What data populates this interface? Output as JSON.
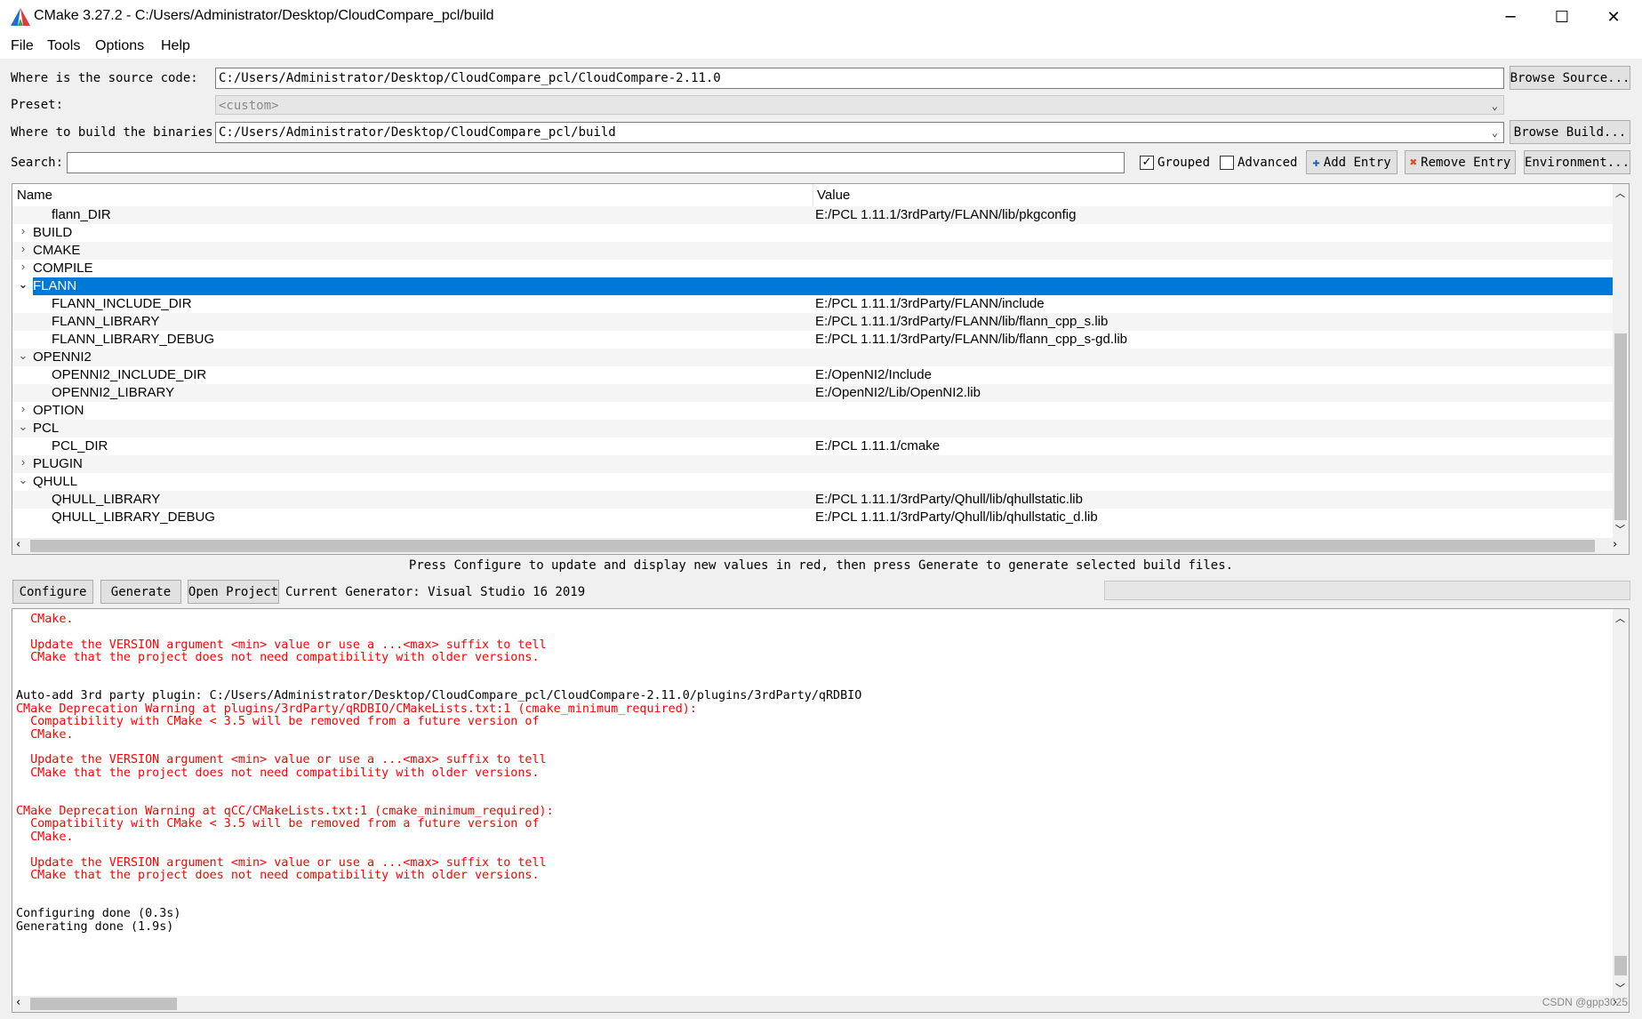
{
  "window": {
    "title": "CMake 3.27.2 - C:/Users/Administrator/Desktop/CloudCompare_pcl/build",
    "minimize": "─",
    "maximize": "☐",
    "close": "✕"
  },
  "menu": [
    "File",
    "Tools",
    "Options",
    "Help"
  ],
  "source": {
    "label": "Where is the source code:",
    "value": "C:/Users/Administrator/Desktop/CloudCompare_pcl/CloudCompare-2.11.0",
    "button": "Browse Source..."
  },
  "preset": {
    "label": "Preset:",
    "value": "<custom>"
  },
  "binaries": {
    "label": "Where to build the binaries:",
    "value": "C:/Users/Administrator/Desktop/CloudCompare_pcl/build",
    "button": "Browse Build..."
  },
  "search": {
    "label": "Search:",
    "value": ""
  },
  "options": {
    "grouped_label": "Grouped",
    "grouped_checked": true,
    "advanced_label": "Advanced",
    "advanced_checked": false,
    "add_entry": "Add Entry",
    "remove_entry": "Remove Entry",
    "environment": "Environment..."
  },
  "table": {
    "col_name": "Name",
    "col_value": "Value",
    "rows": [
      {
        "name": "flann_DIR",
        "value": "E:/PCL 1.11.1/3rdParty/FLANN/lib/pkgconfig",
        "level": 1,
        "arrow": ""
      },
      {
        "name": "BUILD",
        "value": "",
        "level": 0,
        "arrow": "›"
      },
      {
        "name": "CMAKE",
        "value": "",
        "level": 0,
        "arrow": "›"
      },
      {
        "name": "COMPILE",
        "value": "",
        "level": 0,
        "arrow": "›"
      },
      {
        "name": "FLANN",
        "value": "",
        "level": 0,
        "arrow": "⌄",
        "selected": true
      },
      {
        "name": "FLANN_INCLUDE_DIR",
        "value": "E:/PCL 1.11.1/3rdParty/FLANN/include",
        "level": 1,
        "arrow": ""
      },
      {
        "name": "FLANN_LIBRARY",
        "value": "E:/PCL 1.11.1/3rdParty/FLANN/lib/flann_cpp_s.lib",
        "level": 1,
        "arrow": ""
      },
      {
        "name": "FLANN_LIBRARY_DEBUG",
        "value": "E:/PCL 1.11.1/3rdParty/FLANN/lib/flann_cpp_s-gd.lib",
        "level": 1,
        "arrow": ""
      },
      {
        "name": "OPENNI2",
        "value": "",
        "level": 0,
        "arrow": "⌄"
      },
      {
        "name": "OPENNI2_INCLUDE_DIR",
        "value": "E:/OpenNI2/Include",
        "level": 1,
        "arrow": ""
      },
      {
        "name": "OPENNI2_LIBRARY",
        "value": "E:/OpenNI2/Lib/OpenNI2.lib",
        "level": 1,
        "arrow": ""
      },
      {
        "name": "OPTION",
        "value": "",
        "level": 0,
        "arrow": "›"
      },
      {
        "name": "PCL",
        "value": "",
        "level": 0,
        "arrow": "⌄"
      },
      {
        "name": "PCL_DIR",
        "value": "E:/PCL 1.11.1/cmake",
        "level": 1,
        "arrow": ""
      },
      {
        "name": "PLUGIN",
        "value": "",
        "level": 0,
        "arrow": "›"
      },
      {
        "name": "QHULL",
        "value": "",
        "level": 0,
        "arrow": "⌄"
      },
      {
        "name": "QHULL_LIBRARY",
        "value": "E:/PCL 1.11.1/3rdParty/Qhull/lib/qhullstatic.lib",
        "level": 1,
        "arrow": ""
      },
      {
        "name": "QHULL_LIBRARY_DEBUG",
        "value": "E:/PCL 1.11.1/3rdParty/Qhull/lib/qhullstatic_d.lib",
        "level": 1,
        "arrow": ""
      }
    ]
  },
  "hint": "Press Configure to update and display new values in red, then press Generate to generate selected build files.",
  "actions": {
    "configure": "Configure",
    "generate": "Generate",
    "open_project": "Open Project",
    "generator": "Current Generator: Visual Studio 16 2019"
  },
  "output": [
    {
      "text": "  CMake.",
      "color": "red"
    },
    {
      "text": "",
      "color": "red"
    },
    {
      "text": "  Update the VERSION argument <min> value or use a ...<max> suffix to tell",
      "color": "red"
    },
    {
      "text": "  CMake that the project does not need compatibility with older versions.",
      "color": "red"
    },
    {
      "text": "",
      "color": "red"
    },
    {
      "text": "",
      "color": "red"
    },
    {
      "text": "Auto-add 3rd party plugin: C:/Users/Administrator/Desktop/CloudCompare_pcl/CloudCompare-2.11.0/plugins/3rdParty/qRDBIO",
      "color": "black"
    },
    {
      "text": "CMake Deprecation Warning at plugins/3rdParty/qRDBIO/CMakeLists.txt:1 (cmake_minimum_required):",
      "color": "red"
    },
    {
      "text": "  Compatibility with CMake < 3.5 will be removed from a future version of",
      "color": "red"
    },
    {
      "text": "  CMake.",
      "color": "red"
    },
    {
      "text": "",
      "color": "red"
    },
    {
      "text": "  Update the VERSION argument <min> value or use a ...<max> suffix to tell",
      "color": "red"
    },
    {
      "text": "  CMake that the project does not need compatibility with older versions.",
      "color": "red"
    },
    {
      "text": "",
      "color": "red"
    },
    {
      "text": "",
      "color": "red"
    },
    {
      "text": "CMake Deprecation Warning at qCC/CMakeLists.txt:1 (cmake_minimum_required):",
      "color": "red"
    },
    {
      "text": "  Compatibility with CMake < 3.5 will be removed from a future version of",
      "color": "red"
    },
    {
      "text": "  CMake.",
      "color": "red"
    },
    {
      "text": "",
      "color": "red"
    },
    {
      "text": "  Update the VERSION argument <min> value or use a ...<max> suffix to tell",
      "color": "red"
    },
    {
      "text": "  CMake that the project does not need compatibility with older versions.",
      "color": "red"
    },
    {
      "text": "",
      "color": "red"
    },
    {
      "text": "",
      "color": "red"
    },
    {
      "text": "Configuring done (0.3s)",
      "color": "black"
    },
    {
      "text": "Generating done (1.9s)",
      "color": "black"
    }
  ],
  "watermark": "CSDN @gpp3025",
  "colors": {
    "selection": "#0078d7",
    "warning": "#ff0000"
  }
}
